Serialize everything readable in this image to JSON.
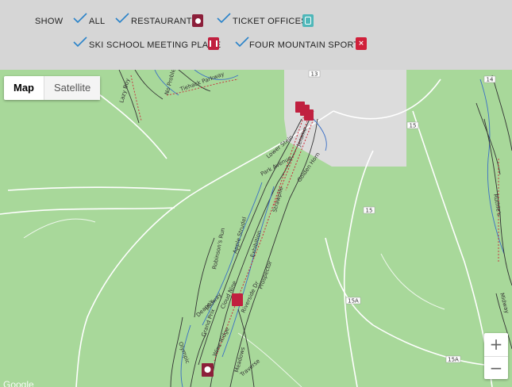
{
  "filters": {
    "show_label": "SHOW",
    "items": [
      {
        "label": "ALL",
        "checked": true
      },
      {
        "label": "RESTAURANTS",
        "checked": true,
        "icon": "restaurant-icon",
        "color": "#8c1f3a"
      },
      {
        "label": "TICKET OFFICES",
        "checked": true,
        "icon": "ticket-office-icon",
        "color": "#4fb7b9"
      },
      {
        "label": "SKI SCHOOL MEETING PLACE",
        "checked": true,
        "icon": "ski-school-icon",
        "color": "#c0203f"
      },
      {
        "label": "FOUR MOUNTAIN SPORTS",
        "checked": true,
        "icon": "four-mountain-sports-icon",
        "color": "#d0203a"
      }
    ],
    "check_color": "#2a83c9"
  },
  "map_type": {
    "map_label": "Map",
    "satellite_label": "Satellite",
    "selected": "Map"
  },
  "zoom": {
    "in_label": "+",
    "out_label": "−"
  },
  "attribution": "Google",
  "colors": {
    "land": "#a8d89a",
    "town": "#dcdcdc",
    "road": "#ffffff",
    "lift": "#c82b3a",
    "trail_blue": "#3a6fc6",
    "trail_black": "#333333"
  },
  "road_shields": [
    "13",
    "14",
    "15",
    "15",
    "15A",
    "15A"
  ],
  "trail_names": [
    "Tiehack Parkway",
    "Lazy Boy",
    "No Problem",
    "Lower Stein",
    "Park Avenue",
    "Golden Horn",
    "Jerome",
    "Strawpile",
    "Robinson's Run",
    "Apple Strudel",
    "Exhibition",
    "Prospector",
    "Midway",
    "Grand Prix",
    "Deane's",
    "Cloud Nine",
    "Riverside Dr",
    "Meadows",
    "Wine Ridge",
    "Olympic",
    "Traverse",
    "Ruthie's",
    "Midway"
  ]
}
